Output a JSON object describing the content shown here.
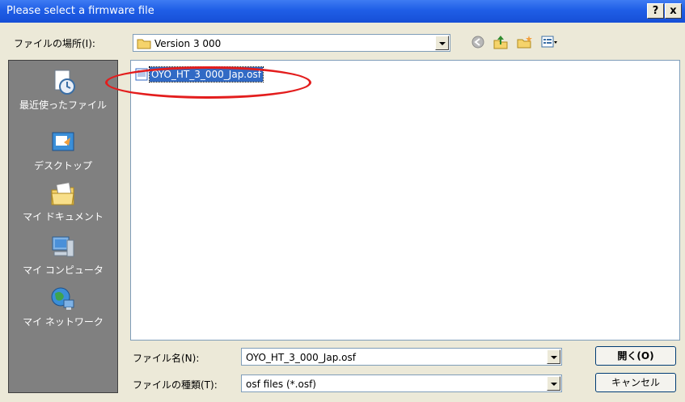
{
  "window": {
    "title": "Please select a firmware file",
    "help_glyph": "?",
    "close_glyph": "x"
  },
  "lookin": {
    "label": "ファイルの場所(I):",
    "value": "Version 3 000"
  },
  "toolbar": {
    "icons": [
      "back-icon",
      "up-folder-icon",
      "new-folder-icon",
      "view-menu-icon"
    ]
  },
  "places": [
    {
      "label": "最近使ったファイル",
      "icon": "recent-files-icon"
    },
    {
      "label": "デスクトップ",
      "icon": "desktop-icon"
    },
    {
      "label": "マイ ドキュメント",
      "icon": "my-documents-icon"
    },
    {
      "label": "マイ コンピュータ",
      "icon": "my-computer-icon"
    },
    {
      "label": "マイ ネットワーク",
      "icon": "my-network-icon"
    }
  ],
  "files": [
    {
      "name": "OYO_HT_3_000_Jap.osf",
      "selected": true
    }
  ],
  "filename": {
    "label": "ファイル名(N):",
    "value": "OYO_HT_3_000_Jap.osf"
  },
  "filetype": {
    "label": "ファイルの種類(T):",
    "value": "osf files (*.osf)"
  },
  "buttons": {
    "open": "開く(O)",
    "cancel": "キャンセル"
  },
  "colors": {
    "titlebar": "#1f5ee6",
    "selection": "#316ac5",
    "callout": "#e31d1d"
  }
}
